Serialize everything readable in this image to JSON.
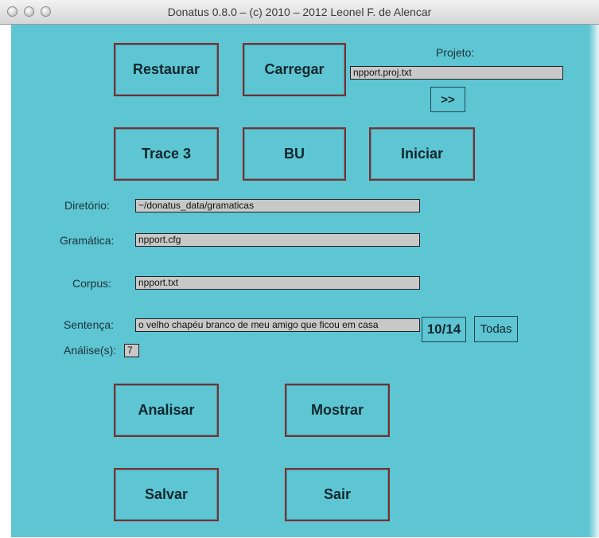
{
  "window": {
    "title": "Donatus 0.8.0 – (c) 2010 – 2012 Leonel F. de Alencar"
  },
  "buttons": {
    "restaurar": "Restaurar",
    "carregar": "Carregar",
    "trace": "Trace 3",
    "bu": "BU",
    "iniciar": "Iniciar",
    "analisar": "Analisar",
    "mostrar": "Mostrar",
    "salvar": "Salvar",
    "sair": "Sair",
    "forward": ">>",
    "todas": "Todas"
  },
  "projeto": {
    "label": "Projeto:",
    "value": "npport.proj.txt"
  },
  "diretorio": {
    "label": "Diretório:",
    "value": "~/donatus_data/gramaticas"
  },
  "gramatica": {
    "label": "Gramática:",
    "value": "npport.cfg"
  },
  "corpus": {
    "label": "Corpus:",
    "value": "npport.txt"
  },
  "sentenca": {
    "label": "Sentença:",
    "value": "o velho chapéu branco de meu amigo que ficou em casa",
    "counter": "10/14"
  },
  "analises": {
    "label": "Análise(s):",
    "value": "7"
  },
  "colors": {
    "background": "#5ec5d3",
    "button_border": "#7e2d2d",
    "field": "#c8c8c8"
  }
}
